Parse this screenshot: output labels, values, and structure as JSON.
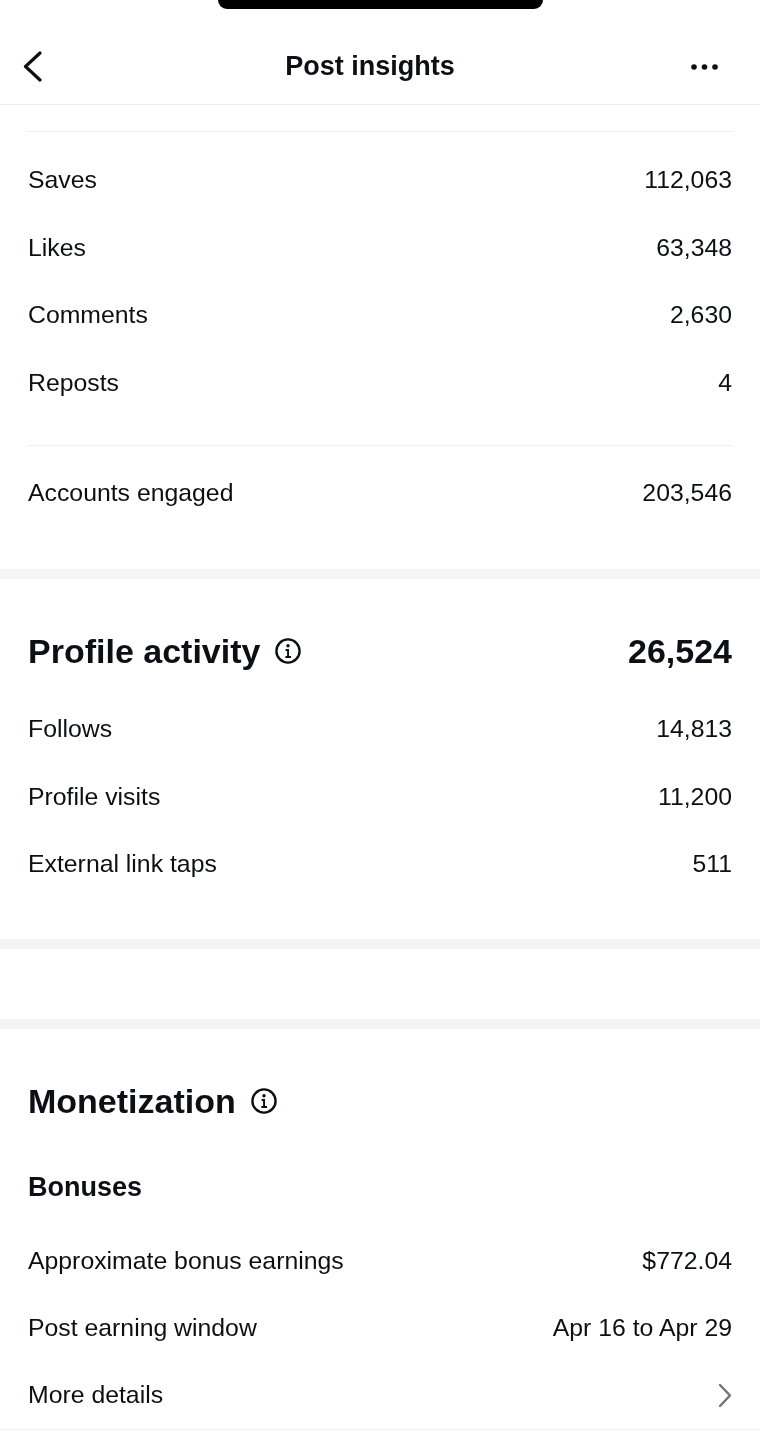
{
  "header": {
    "title": "Post insights"
  },
  "interactions": {
    "metrics": [
      {
        "label": "Saves",
        "value": "112,063"
      },
      {
        "label": "Likes",
        "value": "63,348"
      },
      {
        "label": "Comments",
        "value": "2,630"
      },
      {
        "label": "Reposts",
        "value": "4"
      }
    ]
  },
  "accounts_engaged": {
    "label": "Accounts engaged",
    "value": "203,546"
  },
  "profile_activity": {
    "title": "Profile activity",
    "total": "26,524",
    "metrics": [
      {
        "label": "Follows",
        "value": "14,813"
      },
      {
        "label": "Profile visits",
        "value": "11,200"
      },
      {
        "label": "External link taps",
        "value": "511"
      }
    ]
  },
  "monetization": {
    "title": "Monetization",
    "bonuses": {
      "title": "Bonuses",
      "rows": [
        {
          "kind": "value",
          "label": "Approximate bonus earnings",
          "value": "$772.04"
        },
        {
          "kind": "value",
          "label": "Post earning window",
          "value": "Apr 16 to Apr 29"
        },
        {
          "kind": "link",
          "label": "More details"
        }
      ]
    }
  }
}
